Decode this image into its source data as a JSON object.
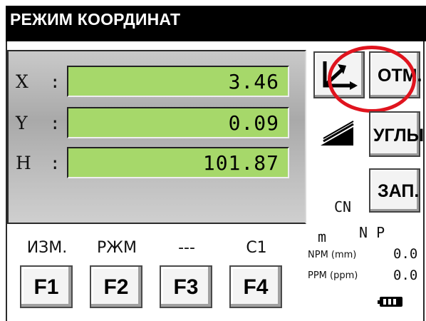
{
  "title": "РЕЖИМ КООРДИНАТ",
  "coordinates": [
    {
      "label": "X",
      "sep": ":",
      "value": "3.46"
    },
    {
      "label": "Y",
      "sep": ":",
      "value": "0.09"
    },
    {
      "label": "H",
      "sep": ":",
      "value": "101.87"
    }
  ],
  "buttons": {
    "otm": "ОТМ.",
    "ugly": "УГЛЫ",
    "zap": "ЗАП."
  },
  "icons": {
    "coord_mode": "axes-arrow-icon",
    "prism": "wedge-icon",
    "battery": "battery-icon"
  },
  "highlight_color": "#e0141e",
  "display_color": "#a6d86a",
  "status": {
    "cn": "CN",
    "m": "m",
    "np": "N P",
    "npm_label": "NPM (mm)",
    "npm_value": "0.0",
    "ppm_label": "PPM (ppm)",
    "ppm_value": "0.0"
  },
  "function_keys": [
    {
      "label": "ИЗМ.",
      "key": "F1"
    },
    {
      "label": "РЖМ",
      "key": "F2"
    },
    {
      "label": "---",
      "key": "F3"
    },
    {
      "label": "C1",
      "key": "F4"
    }
  ]
}
